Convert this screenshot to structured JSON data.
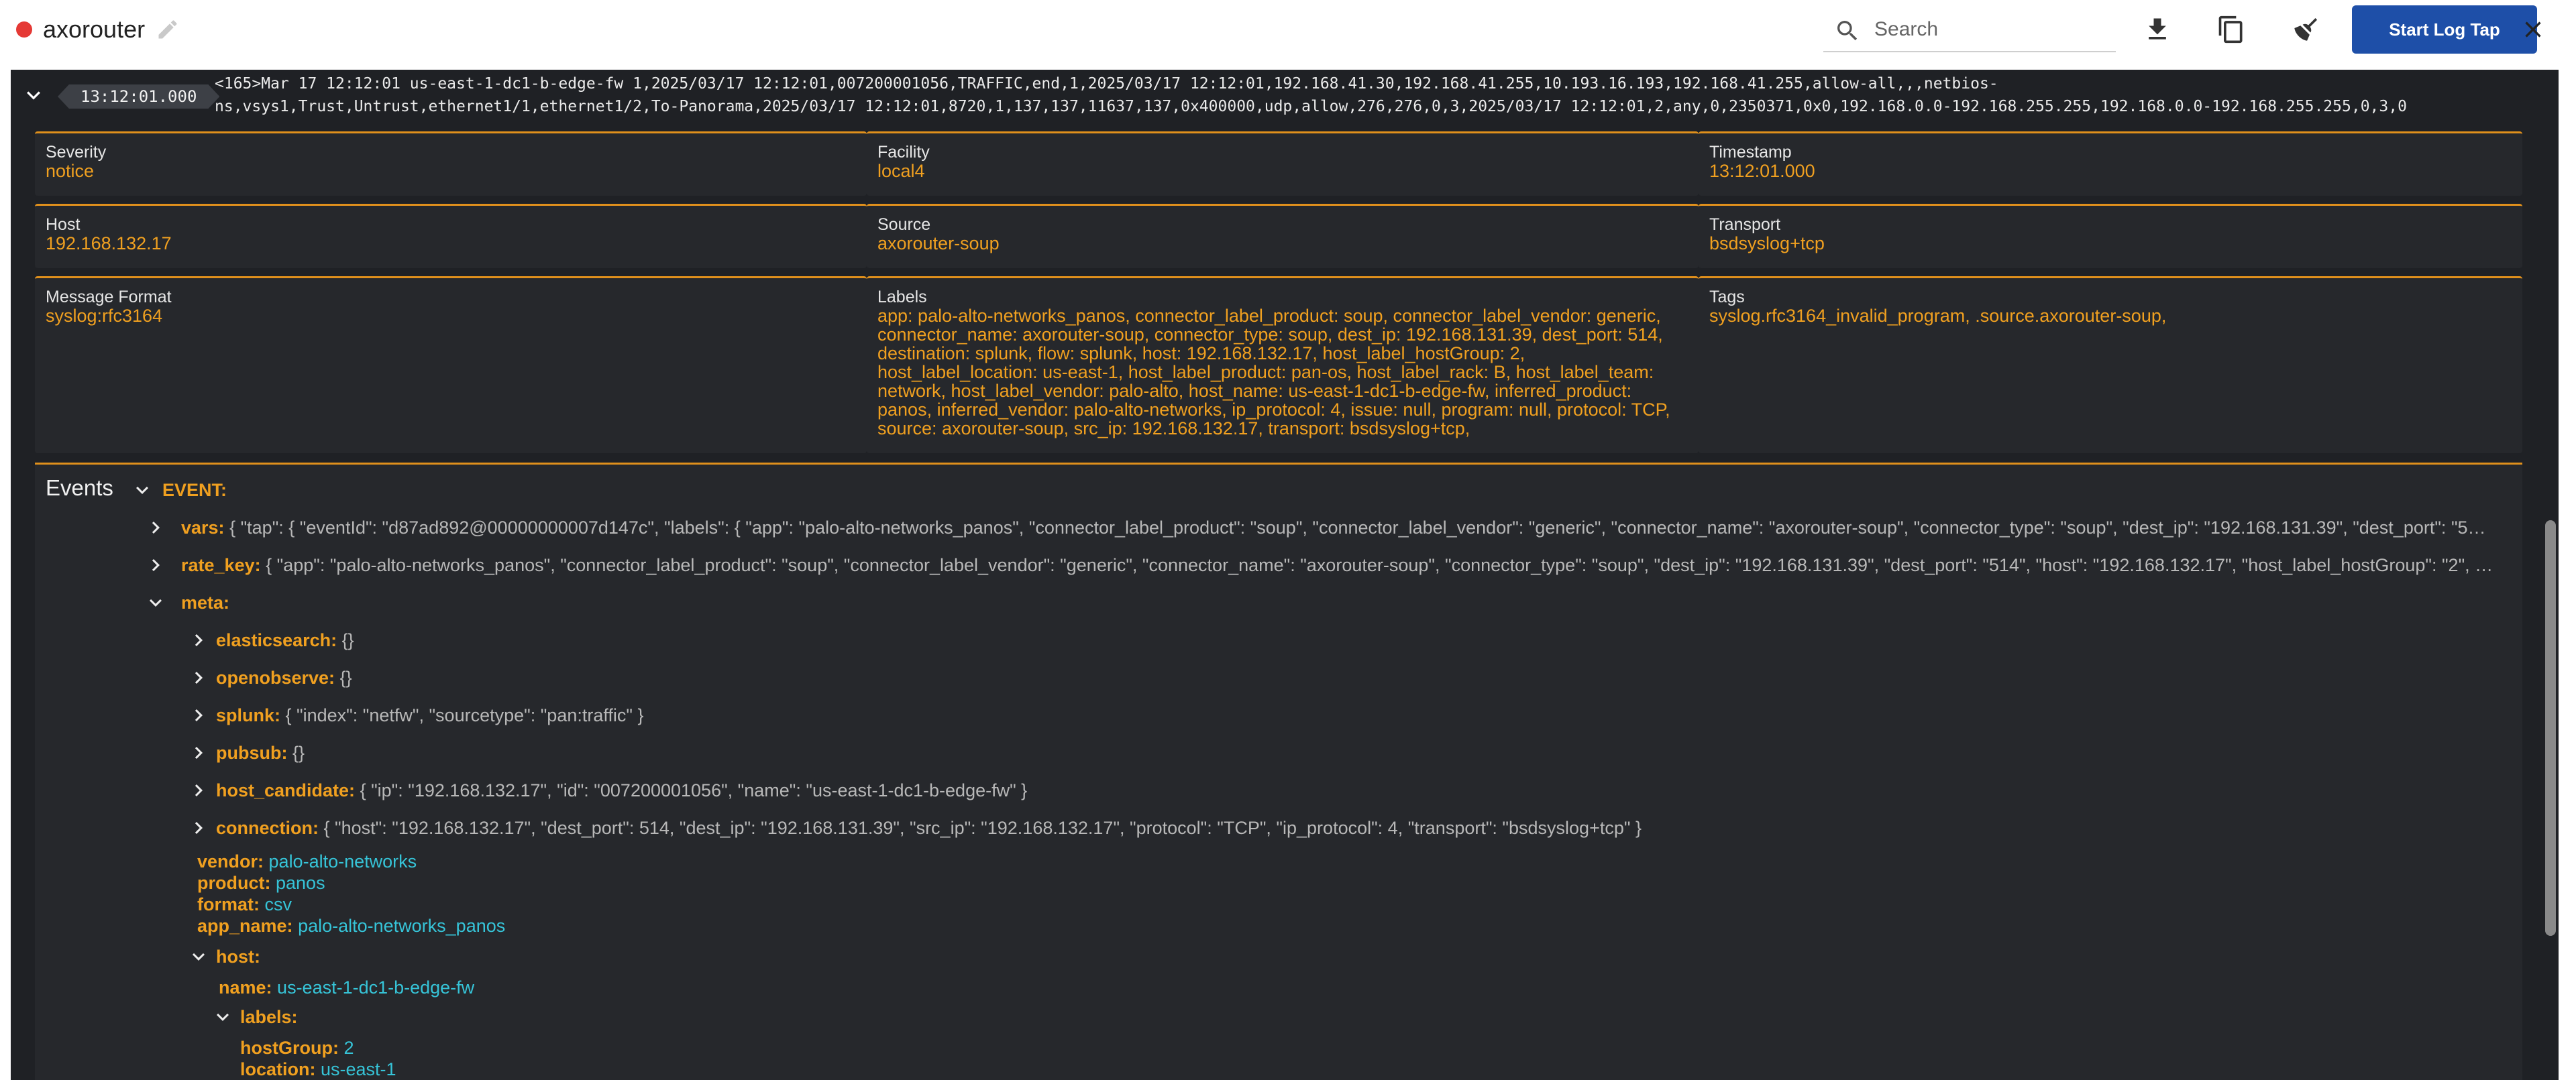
{
  "header": {
    "title": "axorouter",
    "search_placeholder": "Search",
    "start_label": "Start Log Tap"
  },
  "log": {
    "time": "13:12:01.000",
    "raw_line1": "<165>Mar 17 12:12:01 us-east-1-dc1-b-edge-fw 1,2025/03/17 12:12:01,007200001056,TRAFFIC,end,1,2025/03/17 12:12:01,192.168.41.30,192.168.41.255,10.193.16.193,192.168.41.255,allow-all,,,netbios-",
    "raw_line2": "ns,vsys1,Trust,Untrust,ethernet1/1,ethernet1/2,To-Panorama,2025/03/17 12:12:01,8720,1,137,137,11637,137,0x400000,udp,allow,276,276,0,3,2025/03/17 12:12:01,2,any,0,2350371,0x0,192.168.0.0-192.168.255.255,192.168.0.0-192.168.255.255,0,3,0"
  },
  "fields": {
    "severity_label": "Severity",
    "severity": "notice",
    "facility_label": "Facility",
    "facility": "local4",
    "timestamp_label": "Timestamp",
    "timestamp": "13:12:01.000",
    "host_label": "Host",
    "host": "192.168.132.17",
    "source_label": "Source",
    "source": "axorouter-soup",
    "transport_label": "Transport",
    "transport": "bsdsyslog+tcp",
    "format_label": "Message Format",
    "format": "syslog:rfc3164",
    "labels_label": "Labels",
    "labels": "app: palo-alto-networks_panos, connector_label_product: soup, connector_label_vendor: generic, connector_name: axorouter-soup, connector_type: soup, dest_ip: 192.168.131.39, dest_port: 514, destination: splunk, flow: splunk, host: 192.168.132.17, host_label_hostGroup: 2, host_label_location: us-east-1, host_label_product: pan-os, host_label_rack: B, host_label_team: network, host_label_vendor: palo-alto, host_name: us-east-1-dc1-b-edge-fw, inferred_product: panos, inferred_vendor: palo-alto-networks, ip_protocol: 4, issue: null, program: null, protocol: TCP, source: axorouter-soup, src_ip: 192.168.132.17, transport: bsdsyslog+tcp,",
    "tags_label": "Tags",
    "tags": "syslog.rfc3164_invalid_program, .source.axorouter-soup,"
  },
  "events": {
    "title": "Events",
    "event_key": "EVENT:",
    "vars_key": "vars:",
    "vars_val": "{ \"tap\": { \"eventId\": \"d87ad892@00000000007d147c\", \"labels\": { \"app\": \"palo-alto-networks_panos\", \"connector_label_product\": \"soup\", \"connector_label_vendor\": \"generic\", \"connector_name\": \"axorouter-soup\", \"connector_type\": \"soup\", \"dest_ip\": \"192.168.131.39\", \"dest_port\": \"5…",
    "rate_key": "rate_key:",
    "rate_val": "{ \"app\": \"palo-alto-networks_panos\", \"connector_label_product\": \"soup\", \"connector_label_vendor\": \"generic\", \"connector_name\": \"axorouter-soup\", \"connector_type\": \"soup\", \"dest_ip\": \"192.168.131.39\", \"dest_port\": \"514\", \"host\": \"192.168.132.17\", \"host_label_hostGroup\": \"2\", …",
    "meta_key": "meta:",
    "es_key": "elasticsearch:",
    "es_val": "{}",
    "oo_key": "openobserve:",
    "oo_val": "{}",
    "splunk_key": "splunk:",
    "splunk_val": "{ \"index\": \"netfw\", \"sourcetype\": \"pan:traffic\" }",
    "pubsub_key": "pubsub:",
    "pubsub_val": "{}",
    "hc_key": "host_candidate:",
    "hc_val": "{ \"ip\": \"192.168.132.17\", \"id\": \"007200001056\", \"name\": \"us-east-1-dc1-b-edge-fw\" }",
    "conn_key": "connection:",
    "conn_val": "{ \"host\": \"192.168.132.17\", \"dest_port\": 514, \"dest_ip\": \"192.168.131.39\", \"src_ip\": \"192.168.132.17\", \"protocol\": \"TCP\", \"ip_protocol\": 4, \"transport\": \"bsdsyslog+tcp\" }",
    "vendor_key": "vendor:",
    "vendor_val": "palo-alto-networks",
    "product_key": "product:",
    "product_val": "panos",
    "format_key": "format:",
    "format_val": "csv",
    "app_key": "app_name:",
    "app_val": "palo-alto-networks_panos",
    "host_key": "host:",
    "name_key": "name:",
    "name_val": "us-east-1-dc1-b-edge-fw",
    "labels_key": "labels:",
    "hg_key": "hostGroup:",
    "hg_val": "2",
    "loc_key": "location:",
    "loc_val": "us-east-1"
  }
}
